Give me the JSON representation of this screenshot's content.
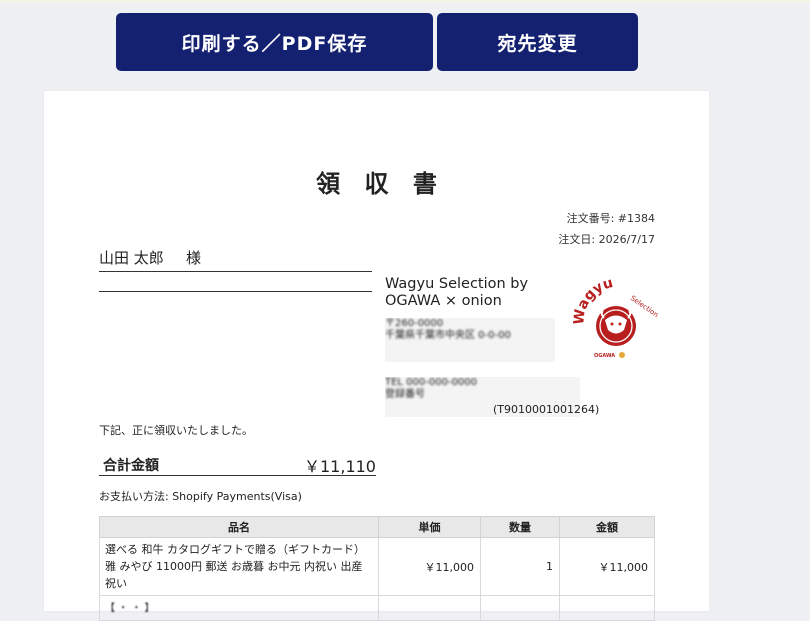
{
  "toolbar": {
    "print_label": "印刷する／PDF保存",
    "address_label": "宛先変更",
    "button_color": "#142171"
  },
  "receipt": {
    "title": "領 収 書",
    "order_number": "注文番号: #1384",
    "order_date": "注文日: 2026/7/17",
    "recipient_name": "山田 太郎",
    "recipient_suffix": "様",
    "issuer_name": "Wagyu Selection by OGAWA × onion",
    "issuer_code": "(T9010001001264)",
    "received_text": "下記、正に領収いたしました。",
    "total_label": "合計金額",
    "total_value": "￥11,110",
    "payment_method": "お支払い方法: Shopify Payments(Visa)"
  },
  "logo": {
    "brand_text": "Wagyu",
    "sub_text": "Selection",
    "footer_text": "OGAWA",
    "accent_color": "#b81e1e"
  },
  "table": {
    "headers": [
      "品名",
      "単価",
      "数量",
      "金額"
    ],
    "rows": [
      {
        "name": "選べる 和牛 カタログギフトで贈る（ギフトカード） 雅 みやび 11000円 郵送 お歳暮 お中元 内祝い 出産祝い",
        "unit_price": "￥11,000",
        "quantity": "1",
        "amount": "￥11,000"
      }
    ]
  }
}
